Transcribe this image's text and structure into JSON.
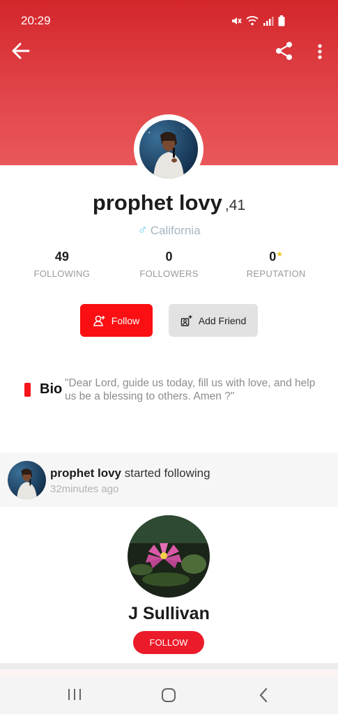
{
  "status_bar": {
    "time": "20:29",
    "icons": [
      "mute-icon",
      "wifi-icon",
      "signal-icon",
      "battery-icon"
    ]
  },
  "header": {
    "back_icon": "arrow-left-icon",
    "share_icon": "share-icon",
    "menu_icon": "more-vertical-icon",
    "colors": {
      "top": "#d3262b",
      "bottom": "#e9575a"
    }
  },
  "profile": {
    "name": "prophet lovy",
    "age": ",41",
    "gender_icon": "male-icon",
    "gender_symbol": "♂",
    "location": "California",
    "stats": [
      {
        "value": "49",
        "label": "FOLLOWING"
      },
      {
        "value": "0",
        "label": "FOLLOWERS"
      },
      {
        "value": "0",
        "label": "REPUTATION",
        "suffix": "★"
      }
    ],
    "follow_label": "Follow",
    "add_friend_label": "Add Friend",
    "bio_label": "Bio",
    "bio_text": "\"Dear Lord, guide us today, fill us with love, and help us be a blessing to others. Amen ?\""
  },
  "activity": {
    "actor": "prophet lovy",
    "action": "started following",
    "time": "32minutes ago",
    "target_name": "J Sullivan",
    "target_follow_label": "FOLLOW"
  },
  "colors": {
    "accent": "#fb0f12",
    "follow_pill": "#ec1b2a",
    "stat_star": "#f4c21a",
    "location_text": "#a7b6c2"
  }
}
